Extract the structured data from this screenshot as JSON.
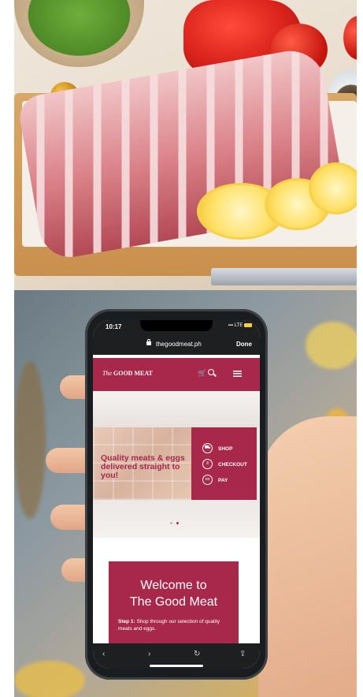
{
  "phone": {
    "status": {
      "time": "10:17",
      "network": "LTE"
    },
    "browser": {
      "url": "thegoodmeat.ph",
      "done_label": "Done",
      "toolbar": {
        "back": "‹",
        "forward": "›",
        "reload": "↻",
        "share": "⇪"
      }
    },
    "site": {
      "logo_the": "The",
      "logo_main": "GOOD MEAT",
      "hero": {
        "caption": "Quality meats & eggs delivered straight to you!",
        "panel_items": [
          {
            "label": "SHOP",
            "icon": "cart-icon"
          },
          {
            "label": "CHECKOUT",
            "icon": "receipt-icon"
          },
          {
            "label": "PAY",
            "icon": "credit-card-icon"
          }
        ]
      },
      "welcome": {
        "title_line1": "Welcome to",
        "title_line2": "The Good Meat",
        "step_label": "Step 1:",
        "step_text": "Shop through our selection of quality meats and eggs."
      }
    }
  },
  "colors": {
    "brand": "#a8284a",
    "browser_chrome": "#1d1f21"
  }
}
